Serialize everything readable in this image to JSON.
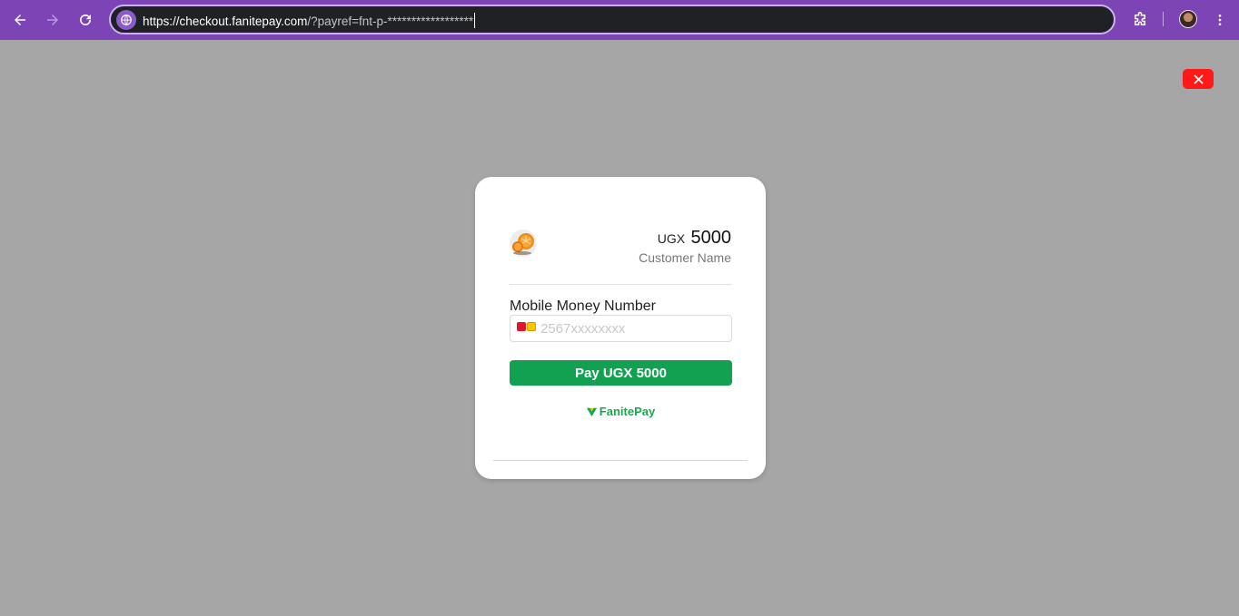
{
  "browser": {
    "url_host": "https://checkout.fanitepay.com",
    "url_path": "/?payref=fnt-p-******************",
    "icons": [
      "back-icon",
      "forward-icon",
      "reload-icon",
      "site-info-icon",
      "extensions-icon",
      "profile-avatar",
      "menu-icon"
    ],
    "colors": {
      "toolbar": "#7c44b5",
      "omnibox": "#202124"
    }
  },
  "checkout": {
    "currency": "UGX",
    "amount": "5000",
    "customer_name": "Customer Name",
    "mobile_money_label": "Mobile Money Number",
    "phone_placeholder": "2567xxxxxxxx",
    "phone_value": "",
    "pay_button": "Pay UGX 5000",
    "brand_name": "FanitePay",
    "colors": {
      "pay_button": "#12a150",
      "close_button": "#ff1a1a",
      "brand": "#1aa84f"
    }
  }
}
